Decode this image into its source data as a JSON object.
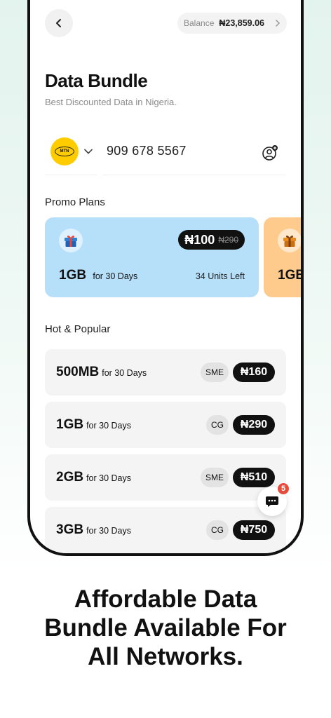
{
  "header": {
    "balance_label": "Balance",
    "balance_amount": "₦23,859.06"
  },
  "page": {
    "title": "Data Bundle",
    "subtitle": "Best Discounted Data in Nigeria."
  },
  "network": {
    "logo_text": "MTN",
    "phone_number": "909 678 5567"
  },
  "promo": {
    "section_title": "Promo Plans",
    "cards": [
      {
        "price": "₦100",
        "old_price": "₦290",
        "size": "1GB",
        "duration": "for 30 Days",
        "units_left": "34 Units Left",
        "color": "#b6e0fa"
      },
      {
        "size": "1GB",
        "color": "#ffcb8d"
      }
    ]
  },
  "popular": {
    "section_title": "Hot & Popular",
    "plans": [
      {
        "size": "500MB",
        "duration": "for 30 Days",
        "type": "SME",
        "price": "₦160"
      },
      {
        "size": "1GB",
        "duration": "for 30 Days",
        "type": "CG",
        "price": "₦290"
      },
      {
        "size": "2GB",
        "duration": "for 30 Days",
        "type": "SME",
        "price": "₦510"
      },
      {
        "size": "3GB",
        "duration": "for 30 Days",
        "type": "CG",
        "price": "₦750"
      }
    ]
  },
  "chat": {
    "badge_count": "5"
  },
  "tagline": {
    "line1": "Affordable Data",
    "line2": "Bundle Available For",
    "line3": "All Networks."
  },
  "colors": {
    "accent_dark": "#111111",
    "mtn_yellow": "#ffcc00",
    "badge_red": "#e64b3c"
  }
}
